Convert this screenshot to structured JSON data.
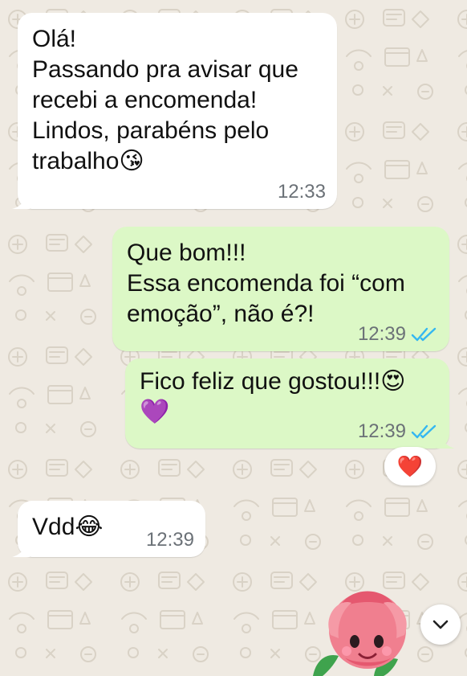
{
  "colors": {
    "background": "#efeae2",
    "incoming_bubble": "#ffffff",
    "outgoing_bubble": "#dcf8c6",
    "timestamp": "#6b7177",
    "read_ticks": "#34b7f1"
  },
  "messages": [
    {
      "direction": "incoming",
      "text": "Olá!\nPassando pra avisar que\nrecebi a encomenda!\nLindos, parabéns pelo\ntrabalho",
      "emoji": "😘",
      "time": "12:33"
    },
    {
      "direction": "outgoing",
      "text": "Que bom!!!\nEssa encomenda foi “com\nemoção”, não é?!",
      "time": "12:39",
      "status_icon": "double-check-icon"
    },
    {
      "direction": "outgoing",
      "text": "Fico feliz que gostou!!!",
      "emoji": "😍",
      "emoji_line2": "💜",
      "time": "12:39",
      "status_icon": "double-check-icon",
      "reaction": "❤️"
    },
    {
      "direction": "incoming",
      "text": "Vdd",
      "emoji": "😂",
      "time": "12:39"
    }
  ],
  "sticker": {
    "icon": "rose-sticker-icon"
  },
  "scroll_button": {
    "icon": "chevron-down-icon"
  }
}
